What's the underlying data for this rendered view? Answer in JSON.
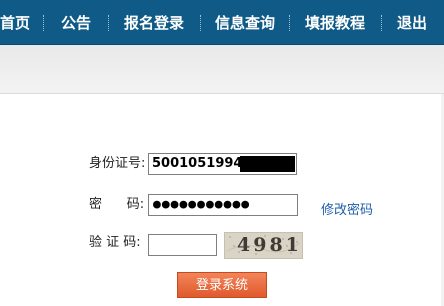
{
  "nav": {
    "items": [
      {
        "label": "首页"
      },
      {
        "label": "公告"
      },
      {
        "label": "报名登录"
      },
      {
        "label": "信息查询"
      },
      {
        "label": "填报教程"
      },
      {
        "label": "退出"
      }
    ]
  },
  "form": {
    "id_label": "身份证号:",
    "id_value": "50010519940",
    "password_label": "密      码:",
    "password_value": "●●●●●●●●●●●",
    "change_password_link": "修改密码",
    "captcha_label": "验 证 码:",
    "captcha_value": "",
    "captcha_image_text": "4981",
    "submit_label": "登录系统"
  },
  "colors": {
    "nav_bg": "#0f5a86",
    "button_bg": "#e8663a",
    "link": "#1f5fa8"
  }
}
